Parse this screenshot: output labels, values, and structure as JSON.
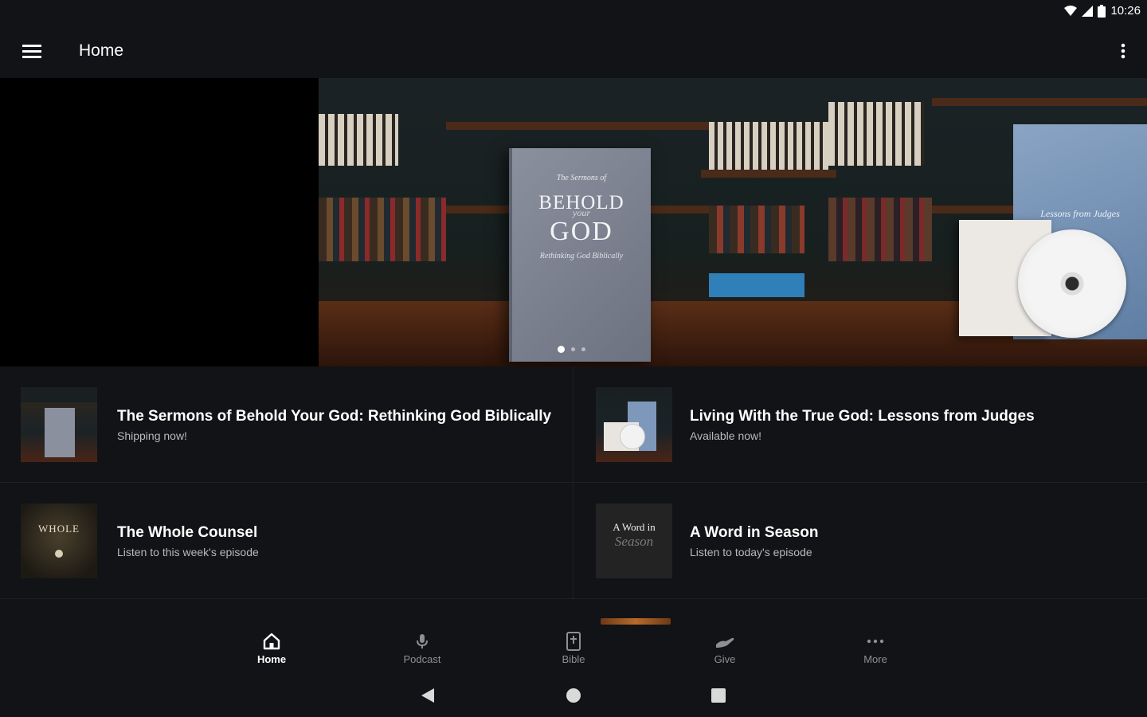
{
  "status": {
    "time": "10:26",
    "wifi_icon": "wifi-icon",
    "signal_icon": "cell-signal-icon",
    "battery_icon": "battery-icon"
  },
  "appbar": {
    "title": "Home",
    "menu_icon": "hamburger-menu-icon",
    "overflow_icon": "more-vertical-icon"
  },
  "hero": {
    "book_lines": [
      "The Sermons of",
      "BEHOLD",
      "your",
      "GOD",
      "Rethinking God Biblically"
    ],
    "box_set_text": "Lessons from Judges",
    "pager": {
      "count": 3,
      "active_index": 0
    }
  },
  "cards": [
    {
      "title": "The Sermons of Behold Your God: Rethinking God Biblically",
      "subtitle": "Shipping now!"
    },
    {
      "title": "Living With the True God: Lessons from Judges",
      "subtitle": "Available now!"
    },
    {
      "title": "The Whole Counsel",
      "subtitle": "Listen to this week's episode",
      "thumb_text": "WHOLE"
    },
    {
      "title": "A Word in Season",
      "subtitle": "Listen to today's episode",
      "thumb_text_1": "A Word in",
      "thumb_text_2": "Season"
    }
  ],
  "bottom_nav": [
    {
      "label": "Home",
      "icon": "home-icon",
      "active": true
    },
    {
      "label": "Podcast",
      "icon": "microphone-icon",
      "active": false
    },
    {
      "label": "Bible",
      "icon": "bible-icon",
      "active": false
    },
    {
      "label": "Give",
      "icon": "give-hand-icon",
      "active": false
    },
    {
      "label": "More",
      "icon": "more-horizontal-icon",
      "active": false
    }
  ],
  "system_nav": {
    "back_icon": "back-triangle-icon",
    "home_icon": "home-circle-icon",
    "recents_icon": "recents-square-icon"
  },
  "colors": {
    "background": "#121316",
    "text_primary": "#ffffff",
    "text_secondary": "#b7b9bd",
    "nav_inactive": "#8d8f94"
  }
}
